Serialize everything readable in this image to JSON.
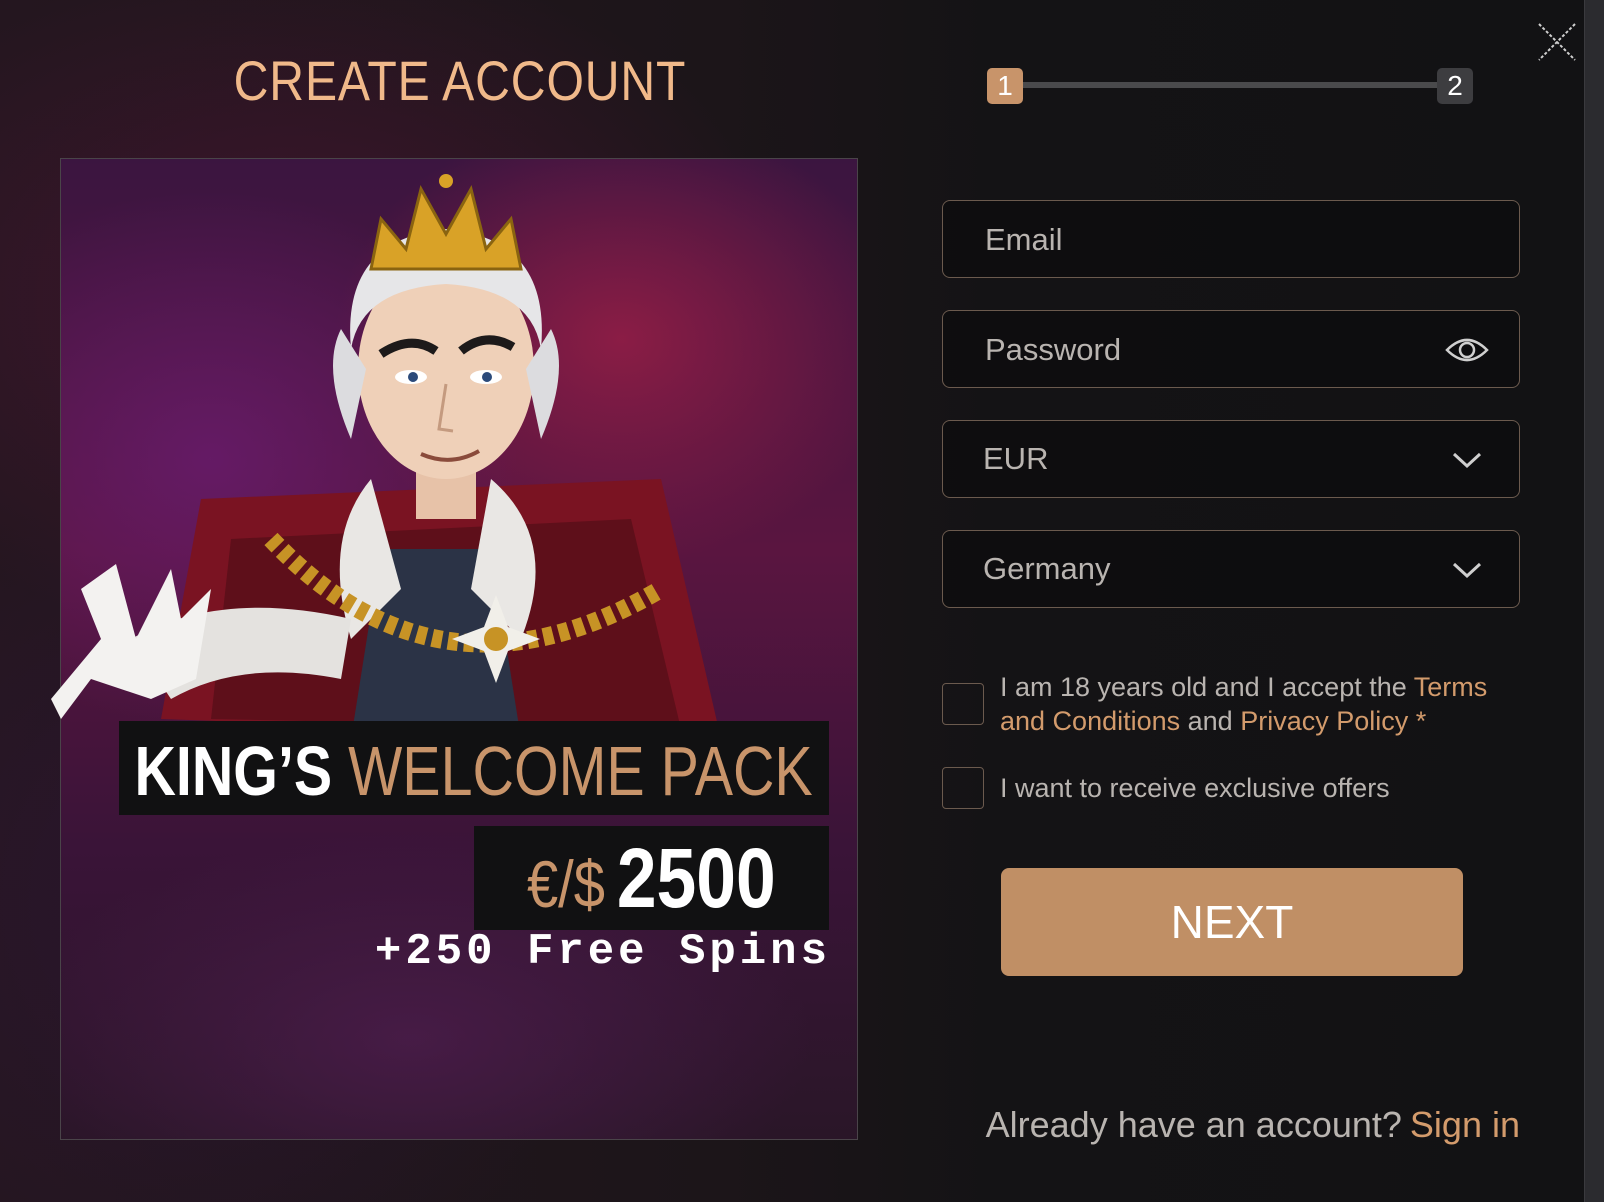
{
  "title": "CREATE ACCOUNT",
  "stepper": {
    "step1": "1",
    "step2": "2",
    "current_step": 1
  },
  "promo": {
    "king_word": "KING’S",
    "welcome_pack": "WELCOME PACK",
    "currency": "€/$",
    "amount": "2500",
    "free_spins": "+250 Free Spins"
  },
  "form": {
    "email_placeholder": "Email",
    "password_placeholder": "Password",
    "currency_value": "EUR",
    "country_value": "Germany",
    "terms_prefix": "I am 18 years old and I accept the ",
    "terms_link": "Terms and Conditions",
    "terms_middle": " and ",
    "privacy_link": "Privacy Policy",
    "terms_suffix": " *",
    "offers_label": "I want to receive exclusive offers",
    "next_button": "NEXT"
  },
  "footer": {
    "prompt": "Already have an account?",
    "signin_link": "Sign in"
  },
  "colors": {
    "accent": "#c8946a",
    "link": "#d39b6c",
    "button": "#c08f65",
    "text": "#b9b4b0"
  },
  "icons": [
    "close-icon",
    "eye-icon",
    "chevron-down-icon",
    "king-mascot-image"
  ]
}
